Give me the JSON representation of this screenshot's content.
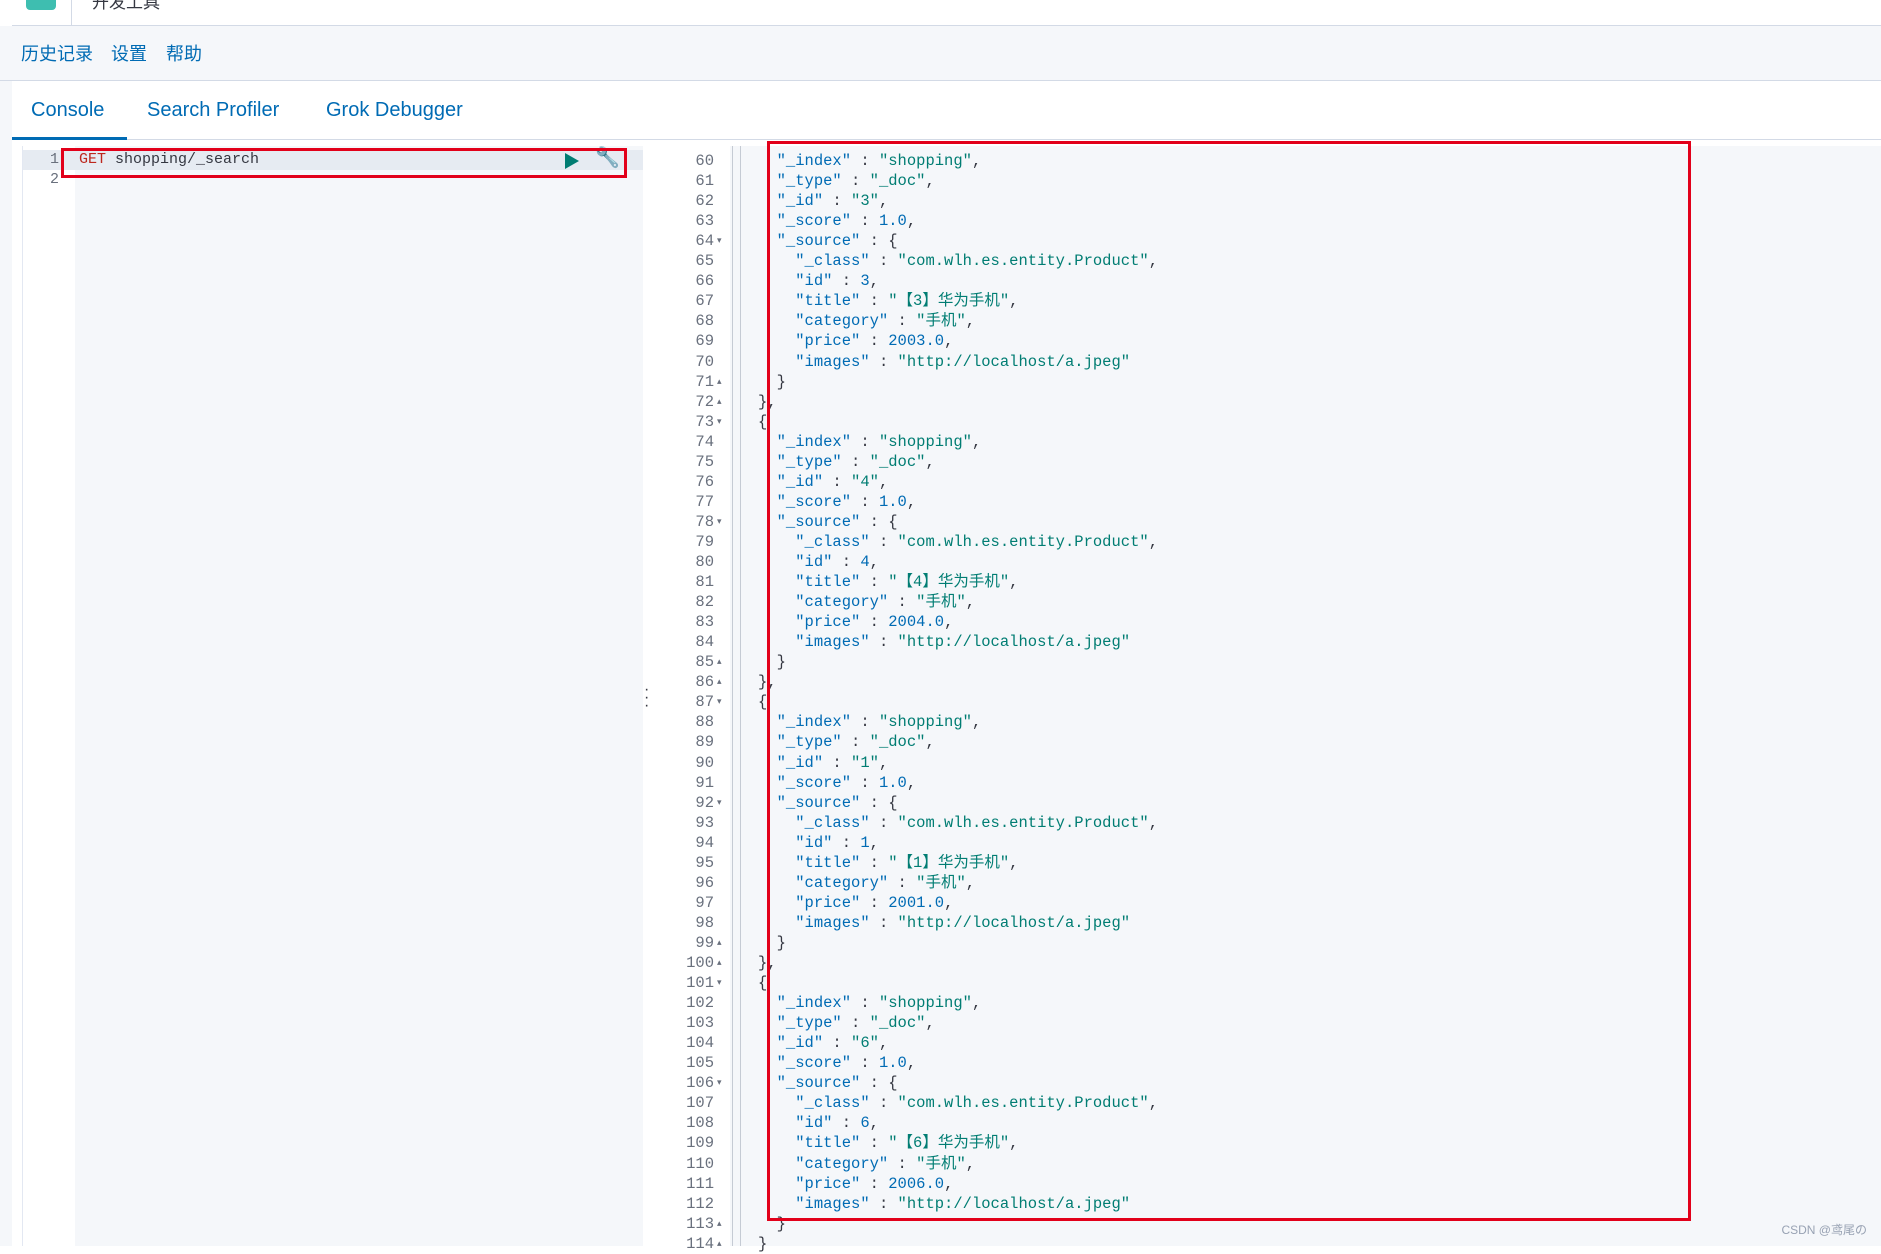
{
  "header": {
    "title": "开发工具"
  },
  "menu": {
    "items": [
      "历史记录",
      "设置",
      "帮助"
    ]
  },
  "tabs": [
    {
      "label": "Console",
      "active": true
    },
    {
      "label": "Search Profiler",
      "active": false
    },
    {
      "label": "Grok Debugger",
      "active": false
    }
  ],
  "request_editor": {
    "lines": [
      {
        "num": "1",
        "method": "GET",
        "path": "shopping/_search"
      },
      {
        "num": "2",
        "method": "",
        "path": ""
      }
    ],
    "run_icon": "play-icon",
    "settings_icon": "wrench-icon"
  },
  "response_start_line": 60,
  "response_lines": [
    {
      "text": "  \"_index\" : \"shopping\",",
      "fold": ""
    },
    {
      "text": "  \"_type\" : \"_doc\",",
      "fold": ""
    },
    {
      "text": "  \"_id\" : \"3\",",
      "fold": ""
    },
    {
      "text": "  \"_score\" : 1.0,",
      "fold": ""
    },
    {
      "text": "  \"_source\" : {",
      "fold": "▾"
    },
    {
      "text": "    \"_class\" : \"com.wlh.es.entity.Product\",",
      "fold": ""
    },
    {
      "text": "    \"id\" : 3,",
      "fold": ""
    },
    {
      "text": "    \"title\" : \"【3】华为手机\",",
      "fold": ""
    },
    {
      "text": "    \"category\" : \"手机\",",
      "fold": ""
    },
    {
      "text": "    \"price\" : 2003.0,",
      "fold": ""
    },
    {
      "text": "    \"images\" : \"http://localhost/a.jpeg\"",
      "fold": ""
    },
    {
      "text": "  }",
      "fold": "▴"
    },
    {
      "text": "},",
      "fold": "▴"
    },
    {
      "text": "{",
      "fold": "▾"
    },
    {
      "text": "  \"_index\" : \"shopping\",",
      "fold": ""
    },
    {
      "text": "  \"_type\" : \"_doc\",",
      "fold": ""
    },
    {
      "text": "  \"_id\" : \"4\",",
      "fold": ""
    },
    {
      "text": "  \"_score\" : 1.0,",
      "fold": ""
    },
    {
      "text": "  \"_source\" : {",
      "fold": "▾"
    },
    {
      "text": "    \"_class\" : \"com.wlh.es.entity.Product\",",
      "fold": ""
    },
    {
      "text": "    \"id\" : 4,",
      "fold": ""
    },
    {
      "text": "    \"title\" : \"【4】华为手机\",",
      "fold": ""
    },
    {
      "text": "    \"category\" : \"手机\",",
      "fold": ""
    },
    {
      "text": "    \"price\" : 2004.0,",
      "fold": ""
    },
    {
      "text": "    \"images\" : \"http://localhost/a.jpeg\"",
      "fold": ""
    },
    {
      "text": "  }",
      "fold": "▴"
    },
    {
      "text": "},",
      "fold": "▴"
    },
    {
      "text": "{",
      "fold": "▾"
    },
    {
      "text": "  \"_index\" : \"shopping\",",
      "fold": ""
    },
    {
      "text": "  \"_type\" : \"_doc\",",
      "fold": ""
    },
    {
      "text": "  \"_id\" : \"1\",",
      "fold": ""
    },
    {
      "text": "  \"_score\" : 1.0,",
      "fold": ""
    },
    {
      "text": "  \"_source\" : {",
      "fold": "▾"
    },
    {
      "text": "    \"_class\" : \"com.wlh.es.entity.Product\",",
      "fold": ""
    },
    {
      "text": "    \"id\" : 1,",
      "fold": ""
    },
    {
      "text": "    \"title\" : \"【1】华为手机\",",
      "fold": ""
    },
    {
      "text": "    \"category\" : \"手机\",",
      "fold": ""
    },
    {
      "text": "    \"price\" : 2001.0,",
      "fold": ""
    },
    {
      "text": "    \"images\" : \"http://localhost/a.jpeg\"",
      "fold": ""
    },
    {
      "text": "  }",
      "fold": "▴"
    },
    {
      "text": "},",
      "fold": "▴"
    },
    {
      "text": "{",
      "fold": "▾"
    },
    {
      "text": "  \"_index\" : \"shopping\",",
      "fold": ""
    },
    {
      "text": "  \"_type\" : \"_doc\",",
      "fold": ""
    },
    {
      "text": "  \"_id\" : \"6\",",
      "fold": ""
    },
    {
      "text": "  \"_score\" : 1.0,",
      "fold": ""
    },
    {
      "text": "  \"_source\" : {",
      "fold": "▾"
    },
    {
      "text": "    \"_class\" : \"com.wlh.es.entity.Product\",",
      "fold": ""
    },
    {
      "text": "    \"id\" : 6,",
      "fold": ""
    },
    {
      "text": "    \"title\" : \"【6】华为手机\",",
      "fold": ""
    },
    {
      "text": "    \"category\" : \"手机\",",
      "fold": ""
    },
    {
      "text": "    \"price\" : 2006.0,",
      "fold": ""
    },
    {
      "text": "    \"images\" : \"http://localhost/a.jpeg\"",
      "fold": ""
    },
    {
      "text": "  }",
      "fold": "▴"
    },
    {
      "text": "}",
      "fold": "▴"
    }
  ],
  "watermark": "CSDN @鸢尾の",
  "colors": {
    "accent": "#006bb4",
    "string": "#017d73",
    "highlight_box": "#e2001a"
  }
}
